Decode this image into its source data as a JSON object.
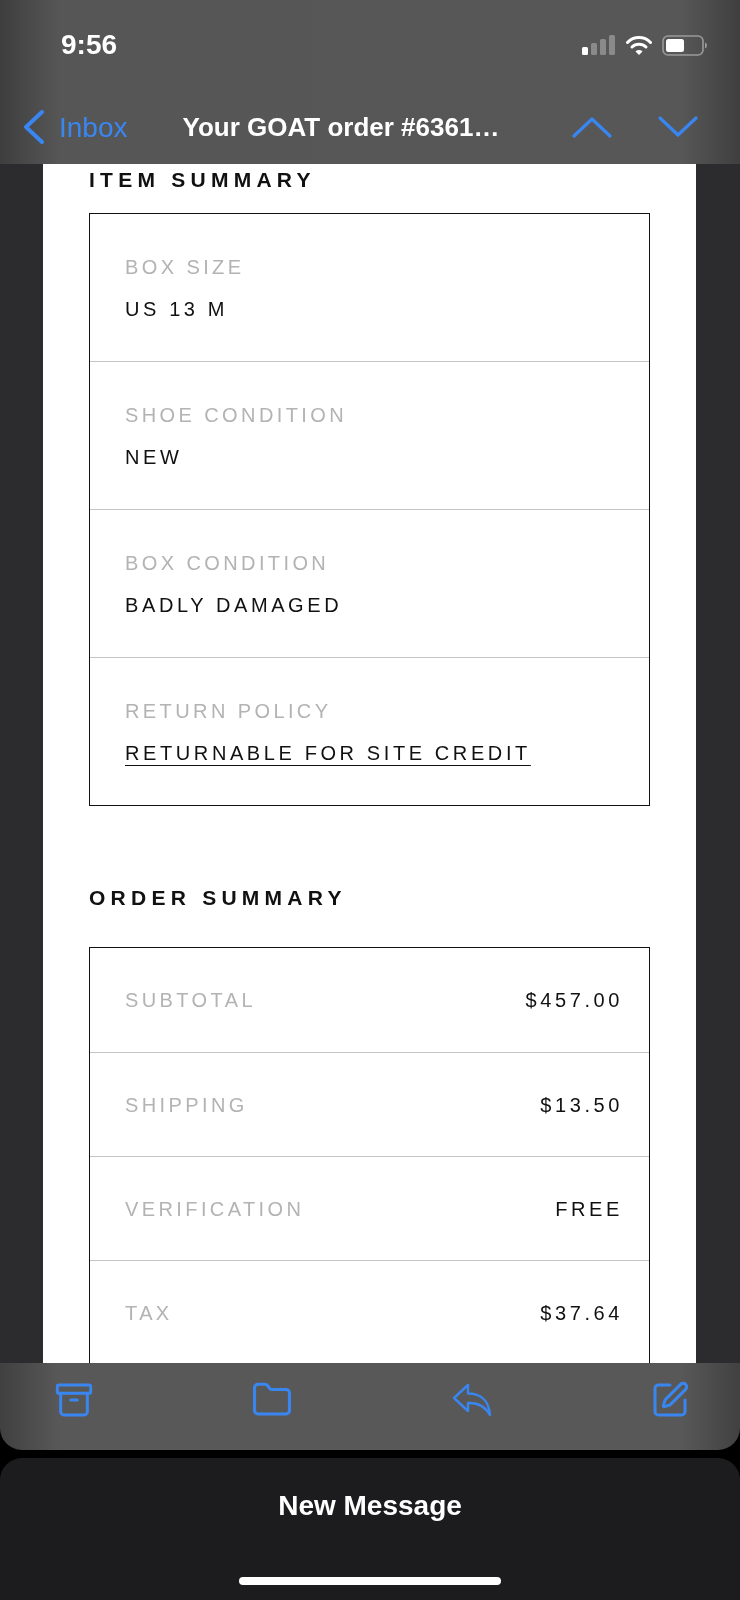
{
  "status_bar": {
    "time": "9:56"
  },
  "nav_bar": {
    "back_label": "Inbox",
    "title": "Your GOAT order #6361…"
  },
  "item_summary": {
    "heading": "ITEM SUMMARY",
    "rows": [
      {
        "kind": "text",
        "label": "BOX SIZE",
        "value": "US 13 M"
      },
      {
        "kind": "text",
        "label": "SHOE CONDITION",
        "value": "NEW"
      },
      {
        "kind": "text",
        "label": "BOX CONDITION",
        "value": "BADLY DAMAGED"
      },
      {
        "kind": "link",
        "label": "RETURN POLICY",
        "value": "RETURNABLE FOR SITE CREDIT"
      }
    ]
  },
  "order_summary": {
    "heading": "ORDER SUMMARY",
    "rows": [
      {
        "label": "SUBTOTAL",
        "value": "$457.00"
      },
      {
        "label": "SHIPPING",
        "value": "$13.50"
      },
      {
        "label": "VERIFICATION",
        "value": "FREE"
      },
      {
        "label": "TAX",
        "value": "$37.64"
      }
    ]
  },
  "compose_sheet": {
    "title": "New Message"
  }
}
